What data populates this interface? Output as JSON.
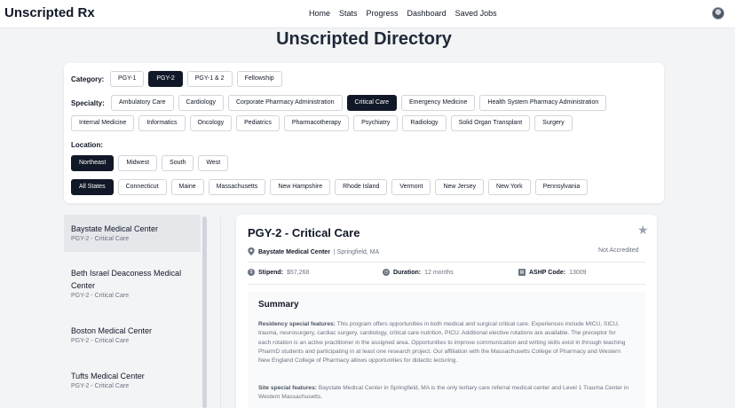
{
  "header": {
    "brand": "Unscripted Rx",
    "nav": [
      "Home",
      "Stats",
      "Progress",
      "Dashboard",
      "Saved Jobs"
    ]
  },
  "page_title": "Unscripted Directory",
  "filters": {
    "category_label": "Category:",
    "categories": [
      "PGY-1",
      "PGY-2",
      "PGY-1 & 2",
      "Fellowship"
    ],
    "category_selected": "PGY-2",
    "specialty_label": "Specialty:",
    "specialties_row1": [
      "Ambulatory Care",
      "Cardiology",
      "Corporate Pharmacy Administration",
      "Critical Care",
      "Emergency Medicine",
      "Health System Pharmacy Administration"
    ],
    "specialties_row2": [
      "Internal Medicine",
      "Informatics",
      "Oncology",
      "Pediatrics",
      "Pharmacotherapy",
      "Psychiatry",
      "Radiology",
      "Solid Organ Transplant",
      "Surgery"
    ],
    "specialty_selected": "Critical Care",
    "location_label": "Location:",
    "regions": [
      "Northeast",
      "Midwest",
      "South",
      "West"
    ],
    "region_selected": "Northeast",
    "states": [
      "All States",
      "Connecticut",
      "Maine",
      "Massachusetts",
      "New Hampshire",
      "Rhode Island",
      "Vermont",
      "New Jersey",
      "New York",
      "Pennsylvania"
    ],
    "state_selected": "All States"
  },
  "results": [
    {
      "name": "Baystate Medical Center",
      "sub": "PGY-2 - Critical Care"
    },
    {
      "name": "Beth Israel Deaconess Medical Center",
      "sub": "PGY-2 - Critical Care"
    },
    {
      "name": "Boston Medical Center",
      "sub": "PGY-2 - Critical Care"
    },
    {
      "name": "Tufts Medical Center",
      "sub": "PGY-2 - Critical Care"
    }
  ],
  "detail": {
    "title": "PGY-2 - Critical Care",
    "site": "Baystate Medical Center",
    "city": "| Springfield, MA",
    "accreditation": "Not Accredited",
    "stipend_label": "Stipend:",
    "stipend": "$57,268",
    "duration_label": "Duration:",
    "duration": "12 months",
    "ashp_label": "ASHP Code:",
    "ashp": "13009",
    "summary_title": "Summary",
    "residency_label": "Residency special features:",
    "residency_text": "This program offers opportunities in both medical and surgical critical care. Experiences include MICU, SICU, trauma, neurosurgery, cardiac surgery, cardiology, critical care nutrition, PICU. Additional elective rotations are available. The preceptor for each rotation is an active practitioner in the assigned area. Opportunities to improve communication and writing skills exist in through teaching PharmD students and participating in at least one research project. Our affiliation with the Massachusetts College of Pharmacy and Western New England College of Pharmacy allows opportunities for didactic lecturing.",
    "site_label": "Site special features:",
    "site_text": "Baystate Medical Center in Springfield, MA is the only tertiary care referral medical center and Level 1 Trauma Center in Western Massachusetts."
  },
  "colors": {
    "active_chip": "#111827",
    "page_bg": "#f3f4f6"
  }
}
